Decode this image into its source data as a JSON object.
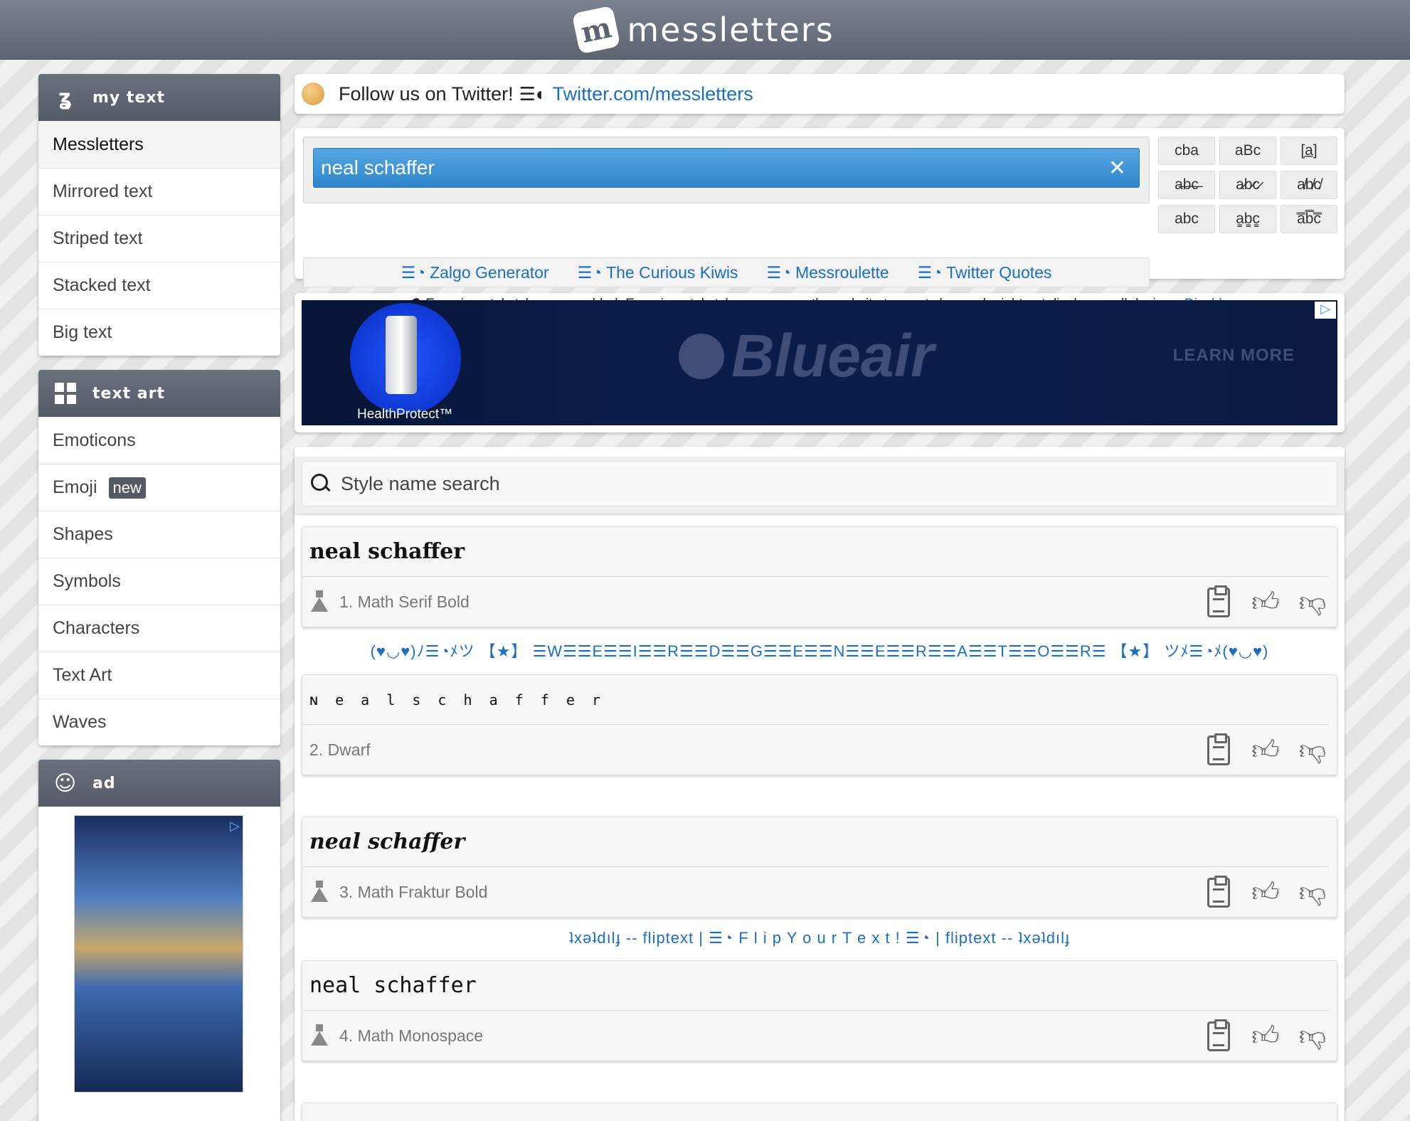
{
  "header": {
    "logo_mark": "m",
    "logo_text": "messletters"
  },
  "sidebar": {
    "my_text": {
      "title": "my text",
      "items": [
        "Messletters",
        "Mirrored text",
        "Striped text",
        "Stacked text",
        "Big text"
      ]
    },
    "text_art": {
      "title": "text art",
      "items": [
        "Emoticons",
        "Emoji",
        "Shapes",
        "Symbols",
        "Characters",
        "Text Art",
        "Waves"
      ],
      "new_badge": "new"
    },
    "ad": {
      "title": "ad"
    }
  },
  "follow": {
    "text": "Follow us on Twitter!",
    "link": "Twitter.com/messletters"
  },
  "editor": {
    "value": "neal schaffer",
    "clear": "✕",
    "transforms": [
      "cba",
      "aBc",
      "[a̲]",
      "a̶b̶c̶",
      "a̷b̷c̷",
      "a̸b̸c̸",
      "abc",
      "a̳b̳c̳",
      "a̿b̿c̿"
    ],
    "quick_links": [
      "Zalgo Generator",
      "The Curious Kiwis",
      "Messroulette",
      "Twitter Quotes"
    ],
    "experimental_note": "Experimental styles are enabled. Experimental styles can cause the website to react slow and might not display on all devices.",
    "disable_label": "Disable"
  },
  "banner": {
    "brand": "Blueair",
    "sub": "HealthProtect™",
    "cta": "LEARN MORE"
  },
  "results": {
    "search_placeholder": "Style name search",
    "styles": [
      {
        "text": "neal schaffer",
        "name": "1. Math Serif Bold"
      },
      {
        "text": "ɴ e a l  s c h a f f e r",
        "name": "2. Dwarf"
      },
      {
        "text": "neal schaffer",
        "name": "3. Math Fraktur Bold"
      },
      {
        "text": "neal schaffer",
        "name": "4. Math Monospace"
      }
    ],
    "promo1": "(♥◡♥)ﾉ☰◔ﾒツ 【★】 ☰W☰☰E☰☰I☰☰R☰☰D☰☰G☰☰E☰☰N☰☰E☰☰R☰☰A☰☰T☰☰O☰☰R☰ 【★】 ツﾒ☰◔ﾒ(♥◡♥)",
    "promo2": "ʇxǝʇdılɟ -- fliptext | ☰◔ F l i p  Y o u r  T e x t !  ☰◔ | fliptext -- ʇxǝʇdılɟ"
  }
}
